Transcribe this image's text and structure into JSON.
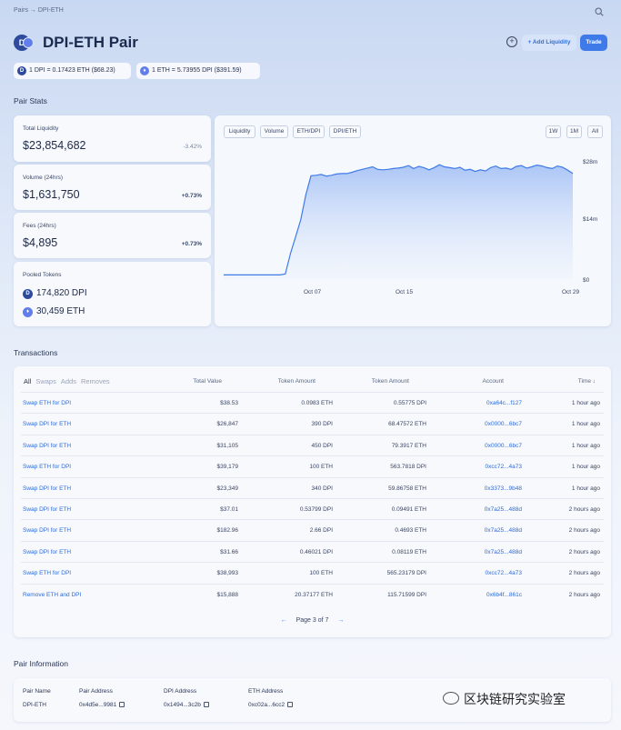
{
  "breadcrumb": "Pairs → DPI-ETH",
  "title": "DPI-ETH Pair",
  "logo_text": "D",
  "eth_icon_glyph": "♦",
  "actions": {
    "add_liquidity": "+ Add Liquidity",
    "trade": "Trade"
  },
  "rates": [
    "1 DPI = 0.17423 ETH ($68.23)",
    "1 ETH = 5.73955 DPI ($391.59)"
  ],
  "stats_heading": "Pair Stats",
  "stats": [
    {
      "label": "Total Liquidity",
      "value": "$23,854,682",
      "change": "-3.42%"
    },
    {
      "label": "Volume (24hrs)",
      "value": "$1,631,750",
      "change": "+0.73%"
    },
    {
      "label": "Fees (24hrs)",
      "value": "$4,895",
      "change": "+0.73%"
    }
  ],
  "pooled": {
    "label": "Pooled Tokens",
    "tokens": [
      {
        "amount": "174,820 DPI",
        "icon": "dpi-icon"
      },
      {
        "amount": "30,459 ETH",
        "icon": "eth-icon"
      }
    ]
  },
  "chart_tabs": [
    "Liquidity",
    "Volume",
    "ETH/DPI",
    "DPI/ETH"
  ],
  "range_tabs": [
    "1W",
    "1M",
    "All"
  ],
  "chart_data": {
    "type": "area",
    "x_ticks": [
      "Oct 07",
      "Oct 15",
      "Oct 29"
    ],
    "y_ticks": [
      "$28m",
      "$14m",
      "$0"
    ],
    "ylim": [
      0,
      28
    ],
    "values": [
      1.0,
      1.0,
      1.0,
      1.0,
      1.0,
      1.0,
      1.0,
      1.0,
      1.0,
      1.0,
      1.0,
      1.0,
      1.2,
      6.0,
      10.0,
      14.0,
      20.0,
      24.5,
      24.6,
      24.8,
      24.4,
      24.6,
      24.9,
      25.0,
      25.0,
      25.3,
      25.7,
      26.0,
      26.3,
      26.6,
      26.0,
      25.9,
      26.0,
      26.2,
      26.3,
      26.5,
      26.9,
      26.2,
      26.7,
      26.4,
      25.9,
      26.4,
      27.1,
      26.6,
      26.4,
      26.2,
      26.5,
      25.8,
      26.0,
      25.5,
      25.9,
      25.6,
      26.4,
      26.8,
      26.2,
      26.3,
      26.0,
      26.7,
      26.9,
      26.3,
      26.6,
      27.0,
      26.8,
      26.4,
      26.2,
      26.8,
      26.5,
      25.8,
      25.0
    ],
    "grid": false,
    "color": "#3f7be8"
  },
  "transactions": {
    "heading": "Transactions",
    "filters": [
      "All",
      "Swaps",
      "Adds",
      "Removes"
    ],
    "headers": [
      "Total Value",
      "Token Amount",
      "Token Amount",
      "Account",
      "Time ↓"
    ],
    "rows": [
      [
        "Swap ETH for DPI",
        "$38.53",
        "0.0983 ETH",
        "0.55775 DPI",
        "0xa64c...f127",
        "1 hour ago"
      ],
      [
        "Swap DPI for ETH",
        "$26,847",
        "390 DPI",
        "68.47572 ETH",
        "0x0000...6bc7",
        "1 hour ago"
      ],
      [
        "Swap DPI for ETH",
        "$31,105",
        "450 DPI",
        "79.3917 ETH",
        "0x0000...6bc7",
        "1 hour ago"
      ],
      [
        "Swap ETH for DPI",
        "$39,179",
        "100 ETH",
        "563.7818 DPI",
        "0xcc72...4a73",
        "1 hour ago"
      ],
      [
        "Swap DPI for ETH",
        "$23,349",
        "340 DPI",
        "59.86758 ETH",
        "0x3373...9b48",
        "1 hour ago"
      ],
      [
        "Swap DPI for ETH",
        "$37.01",
        "0.53799 DPI",
        "0.09491 ETH",
        "0x7a25...488d",
        "2 hours ago"
      ],
      [
        "Swap DPI for ETH",
        "$182.96",
        "2.66 DPI",
        "0.4693 ETH",
        "0x7a25...488d",
        "2 hours ago"
      ],
      [
        "Swap DPI for ETH",
        "$31.66",
        "0.46021 DPI",
        "0.08119 ETH",
        "0x7a25...488d",
        "2 hours ago"
      ],
      [
        "Swap ETH for DPI",
        "$38,993",
        "100 ETH",
        "565.23179 DPI",
        "0xcc72...4a73",
        "2 hours ago"
      ],
      [
        "Remove ETH and DPI",
        "$15,888",
        "20.37177 ETH",
        "115.71599 DPI",
        "0x6b4f...861c",
        "2 hours ago"
      ]
    ],
    "pager": {
      "prev": "←",
      "text": "Page 3 of 7",
      "next": "→"
    }
  },
  "info": {
    "heading": "Pair Information",
    "cols": [
      {
        "h": "Pair Name",
        "v": "DPI-ETH",
        "copy": false
      },
      {
        "h": "Pair Address",
        "v": "0x4d5e...9981",
        "copy": true
      },
      {
        "h": "DPI Address",
        "v": "0x1494...3c2b",
        "copy": true
      },
      {
        "h": "ETH Address",
        "v": "0xc02a...6cc2",
        "copy": true
      }
    ]
  },
  "watermark": "区块链研究实验室",
  "colors": {
    "accent": "#3f7be8",
    "link": "#2e6bd6",
    "dpi": "#2d4a9c",
    "eth": "#627eea"
  }
}
